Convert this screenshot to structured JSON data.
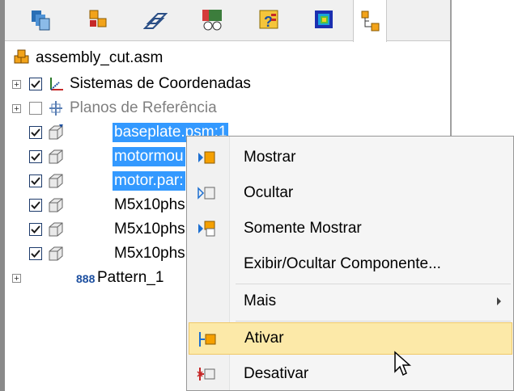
{
  "toolbar": {
    "tabs": [
      {
        "icon": "assembly-pathfinder-icon"
      },
      {
        "icon": "parts-library-icon"
      },
      {
        "icon": "layers-icon"
      },
      {
        "icon": "sensors-icon"
      },
      {
        "icon": "properties-icon"
      },
      {
        "icon": "color-map-icon"
      },
      {
        "icon": "assembly-tree-icon"
      }
    ]
  },
  "tree": {
    "root": "assembly_cut.asm",
    "items": [
      {
        "label": "Sistemas de Coordenadas",
        "checked": true
      },
      {
        "label": "Planos de Referência",
        "checked": false
      },
      {
        "label": "baseplate.psm:1",
        "checked": true,
        "selected": true
      },
      {
        "label": "motormou",
        "checked": true,
        "selected": true
      },
      {
        "label": "motor.par:",
        "checked": true,
        "selected": true
      },
      {
        "label": "M5x10phs",
        "checked": true
      },
      {
        "label": "M5x10phs",
        "checked": true
      },
      {
        "label": "M5x10phs",
        "checked": true
      },
      {
        "label": "Pattern_1"
      }
    ]
  },
  "context_menu": {
    "items": [
      {
        "label": "Mostrar",
        "icon": "show-icon"
      },
      {
        "label": "Ocultar",
        "icon": "hide-icon"
      },
      {
        "label": "Somente Mostrar",
        "icon": "show-only-icon"
      },
      {
        "label": "Exibir/Ocultar Componente...",
        "icon": ""
      },
      {
        "label": "Mais",
        "icon": ""
      },
      {
        "label": "Ativar",
        "icon": "activate-icon"
      },
      {
        "label": "Desativar",
        "icon": "deactivate-icon"
      }
    ],
    "highlighted": "Ativar"
  },
  "colors": {
    "selection": "#3399ff",
    "menu_highlight": "#fce9a8",
    "menu_highlight_border": "#f0c867",
    "menu_icon_orange": "#f5a000",
    "menu_arrow_blue": "#1c6fd1"
  }
}
